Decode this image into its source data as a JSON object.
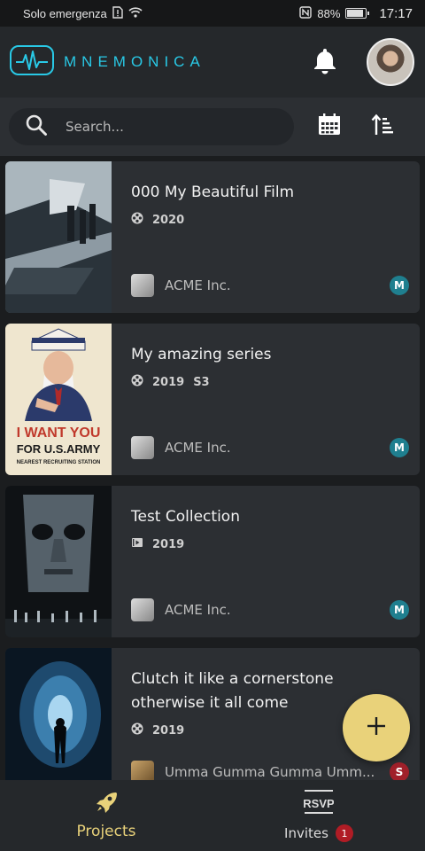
{
  "status_bar": {
    "carrier": "Solo emergenza",
    "battery": "88%",
    "battery_level": 0.88,
    "time": "17:17"
  },
  "header": {
    "brand": "MNEMONICA"
  },
  "search": {
    "placeholder": "Search..."
  },
  "projects": [
    {
      "title": "000 My Beautiful Film",
      "type_icon": "film-reel-icon",
      "year": "2020",
      "season": "",
      "owner": "ACME Inc.",
      "role": "M",
      "role_color": "#1f7f8f"
    },
    {
      "title": "My amazing series",
      "type_icon": "film-reel-icon",
      "year": "2019",
      "season": "S3",
      "owner": "ACME Inc.",
      "role": "M",
      "role_color": "#1f7f8f"
    },
    {
      "title": "Test Collection",
      "type_icon": "collection-play-icon",
      "year": "2019",
      "season": "",
      "owner": "ACME Inc.",
      "role": "M",
      "role_color": "#1f7f8f"
    },
    {
      "title": "Clutch it like a cornerstone otherwise it all come",
      "type_icon": "film-reel-icon",
      "year": "2019",
      "season": "",
      "owner": "Umma Gumma Gumma Umm...",
      "role": "S",
      "role_color": "#a0202a"
    }
  ],
  "poster_text": {
    "line1": "I WANT YOU",
    "line2": "FOR U.S.ARMY",
    "line3": "NEAREST RECRUITING STATION"
  },
  "nav": {
    "projects_label": "Projects",
    "invites_label": "Invites",
    "invites_icon_text": "RSVP",
    "invites_count": "1"
  },
  "colors": {
    "accent": "#29c9e6",
    "nav_active": "#e9d27a",
    "fab": "#e9d27a"
  }
}
